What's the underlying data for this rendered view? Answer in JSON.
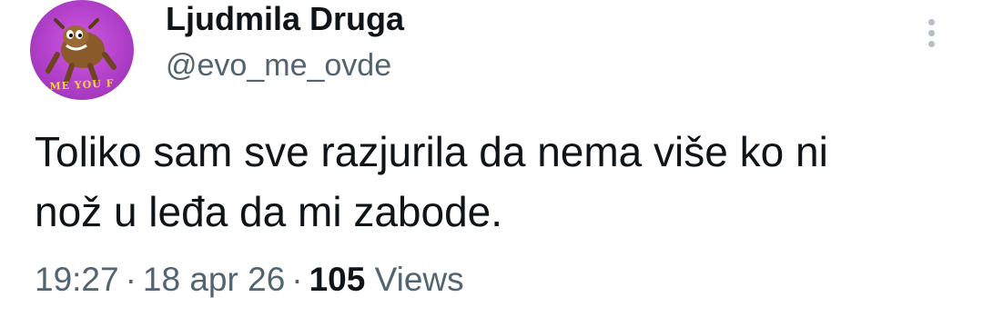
{
  "author": {
    "display_name": "Ljudmila Druga",
    "handle": "@evo_me_ovde",
    "avatar_caption": "ME YOU F"
  },
  "tweet": {
    "text": "Toliko sam sve razjurila da nema više ko ni\nnož u leđa da mi zabode.",
    "time": "19:27",
    "date": "18 apr 26",
    "separator": "·",
    "views_count": "105",
    "views_label": "Views"
  },
  "icons": {
    "more": "more-vertical-icon"
  },
  "colors": {
    "text": "#0f1419",
    "secondary": "#536471",
    "avatar_bg": "#b03fc9"
  }
}
